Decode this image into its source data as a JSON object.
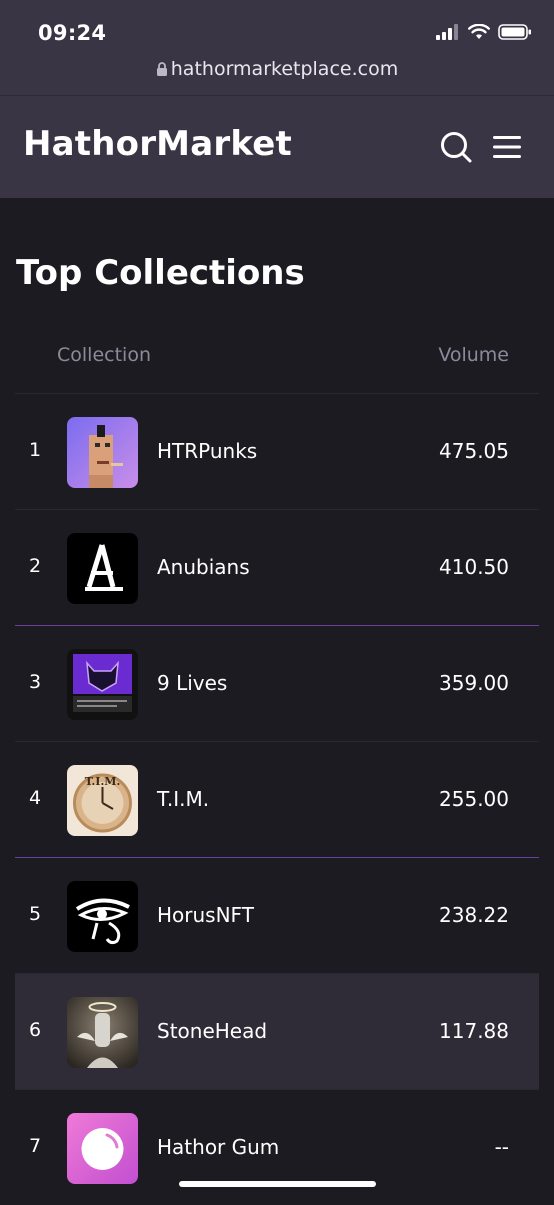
{
  "status": {
    "time": "09:24"
  },
  "browser": {
    "url": "hathormarketplace.com"
  },
  "header": {
    "brand": "HathorMarket",
    "search_icon": "search-icon",
    "menu_icon": "hamburger-menu-icon"
  },
  "page": {
    "title": "Top Collections",
    "columns": {
      "collection": "Collection",
      "volume": "Volume"
    }
  },
  "rows": [
    {
      "rank": "1",
      "name": "HTRPunks",
      "volume": "475.05"
    },
    {
      "rank": "2",
      "name": "Anubians",
      "volume": "410.50"
    },
    {
      "rank": "3",
      "name": "9 Lives",
      "volume": "359.00"
    },
    {
      "rank": "4",
      "name": "T.I.M.",
      "volume": "255.00"
    },
    {
      "rank": "5",
      "name": "HorusNFT",
      "volume": "238.22"
    },
    {
      "rank": "6",
      "name": "StoneHead",
      "volume": "117.88"
    },
    {
      "rank": "7",
      "name": "Hathor Gum",
      "volume": "--"
    }
  ],
  "thumbs": {
    "tim_text": "T.I.M."
  },
  "colors": {
    "accent": "#6b3f9c",
    "header_bg": "#3a3545",
    "page_bg": "#1d1b22"
  }
}
